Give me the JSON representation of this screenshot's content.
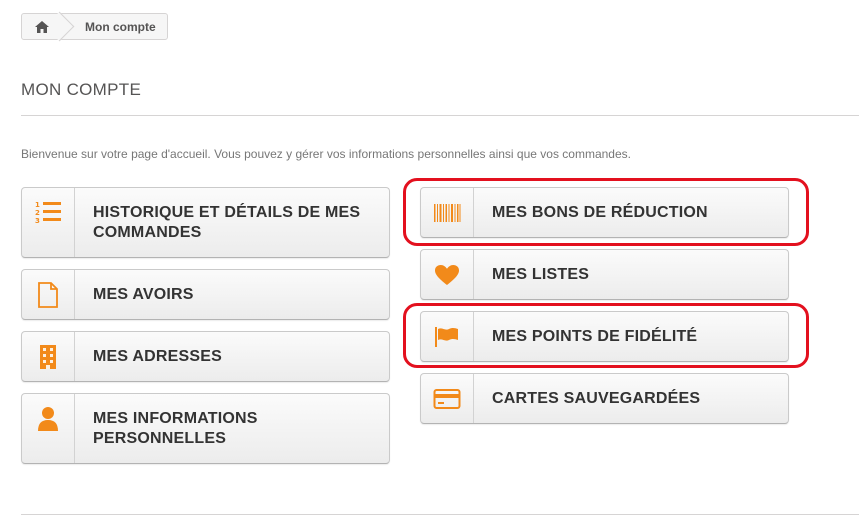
{
  "breadcrumb": {
    "home_icon": "home-icon",
    "current": "Mon compte"
  },
  "page": {
    "heading": "MON COMPTE",
    "welcome": "Bienvenue sur votre page d'accueil. Vous pouvez y gérer vos informations personnelles ainsi que vos commandes."
  },
  "left_buttons": [
    {
      "icon": "ordered-list-icon",
      "label": "HISTORIQUE ET DÉTAILS DE MES COMMANDES"
    },
    {
      "icon": "document-icon",
      "label": "MES AVOIRS"
    },
    {
      "icon": "building-icon",
      "label": "MES ADRESSES"
    },
    {
      "icon": "user-icon",
      "label": "MES INFORMATIONS PERSONNELLES"
    }
  ],
  "right_buttons": [
    {
      "icon": "barcode-icon",
      "label": "MES BONS DE RÉDUCTION"
    },
    {
      "icon": "heart-icon",
      "label": "MES LISTES"
    },
    {
      "icon": "flag-icon",
      "label": "MES POINTS DE FIDÉLITÉ"
    },
    {
      "icon": "credit-card-icon",
      "label": "CARTES SAUVEGARDÉES"
    }
  ],
  "colors": {
    "accent": "#f28a1a",
    "highlight": "#e3101e",
    "text": "#333333"
  }
}
